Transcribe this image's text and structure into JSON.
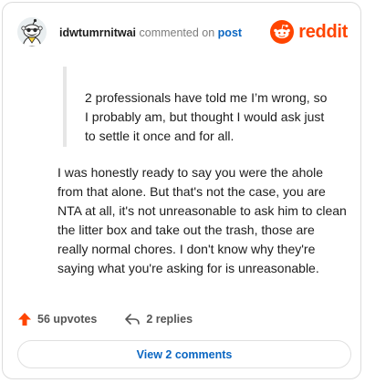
{
  "header": {
    "username": "idwtumrnitwai",
    "action_text": " commented on ",
    "post_link": "post",
    "brand": "reddit"
  },
  "quote": {
    "text": "2 professionals have told me I’m wrong, so I probably am, but thought I would ask just to settle it once and for all."
  },
  "comment": {
    "text": "I was honestly ready to say you were the ahole from that alone. But that's not the case, you are NTA at all, it's not unreasonable to ask him to clean the litter box and take out the trash, those are really normal chores. I don't know why they're saying what you're asking for is unreasonable."
  },
  "actions": {
    "upvotes_label": "56 upvotes",
    "replies_label": "2 replies"
  },
  "footer": {
    "view_comments_label": "View 2 comments"
  },
  "colors": {
    "brand": "#ff4500",
    "link": "#0a66c2",
    "quote_bar": "#e6e6e6"
  },
  "icons": {
    "avatar": "snoo-avatar",
    "logo": "reddit-alien-icon",
    "upvote": "upvote-arrow-icon",
    "reply": "reply-arrow-icon"
  }
}
